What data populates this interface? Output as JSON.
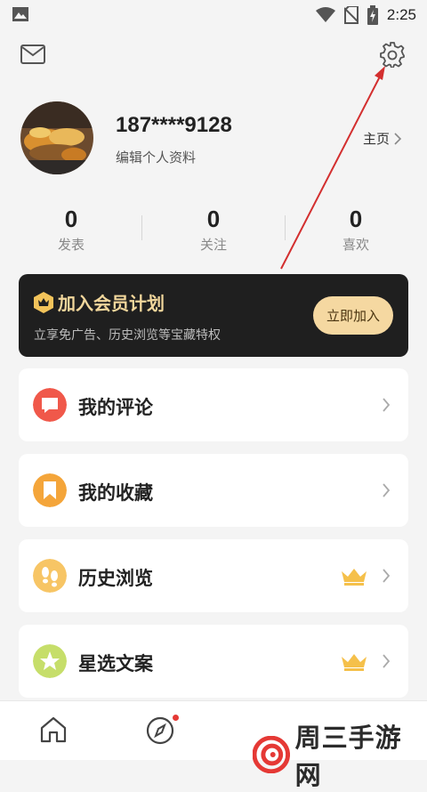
{
  "status_bar": {
    "time": "2:25",
    "icons": [
      "image-icon",
      "wifi-icon",
      "no-sim-icon",
      "battery-charging-icon"
    ]
  },
  "header": {
    "icons": [
      "mail-icon",
      "gear-icon"
    ]
  },
  "profile": {
    "username": "187****9128",
    "edit_profile": "编辑个人资料",
    "homepage": "主页"
  },
  "stats": [
    {
      "value": "0",
      "label": "发表"
    },
    {
      "value": "0",
      "label": "关注"
    },
    {
      "value": "0",
      "label": "喜欢"
    }
  ],
  "vip": {
    "title": "加入会员计划",
    "subtitle": "立享免广告、历史浏览等宝藏特权",
    "button": "立即加入",
    "colors": {
      "card": "#1f1f1f",
      "gold": "#f2d79c",
      "button": "#f5d8a1"
    }
  },
  "menu": [
    {
      "label": "我的评论",
      "icon": "comment-icon",
      "color": "#f0584a",
      "crown": false
    },
    {
      "label": "我的收藏",
      "icon": "bookmark-icon",
      "color": "#f4a53a",
      "crown": false
    },
    {
      "label": "历史浏览",
      "icon": "footprints-icon",
      "color": "#f7c565",
      "crown": true
    },
    {
      "label": "星选文案",
      "icon": "star-icon",
      "color": "#c6de6a",
      "crown": true
    }
  ],
  "bottom_nav": {
    "icons": [
      "home-icon",
      "compass-icon"
    ]
  },
  "watermark": {
    "text": "周三手游网"
  }
}
